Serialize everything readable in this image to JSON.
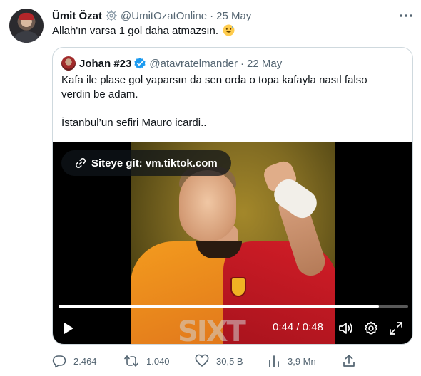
{
  "tweet": {
    "name": "Ümit Özat",
    "handle": "@UmitOzatOnline",
    "separator": "·",
    "date": "25 May",
    "text": "Allah'ın varsa 1 gol daha atmazsın."
  },
  "quote": {
    "name": "Johan #23",
    "handle": "@atavratelmander",
    "separator": "·",
    "date": "22 May",
    "line1": "Kafa ile plase gol yaparsın da sen orda o topa kafayla nasıl falso",
    "line2": "verdin be adam.",
    "line3": "İstanbul’un sefiri Mauro icardi..",
    "video": {
      "site_label": "Siteye git: vm.tiktok.com",
      "sponsor_text": "SIXT",
      "current_time": "0:44",
      "duration": "0:48",
      "time_separator": " / ",
      "progress": 0.917
    }
  },
  "stats": {
    "replies": "2.464",
    "reposts": "1.040",
    "likes": "30,5 B",
    "views": "3,9 Mn"
  },
  "colors": {
    "text": "#0f1419",
    "secondary": "#536471",
    "border": "#cfd9de",
    "verified_blue": "#1d9bf0"
  }
}
